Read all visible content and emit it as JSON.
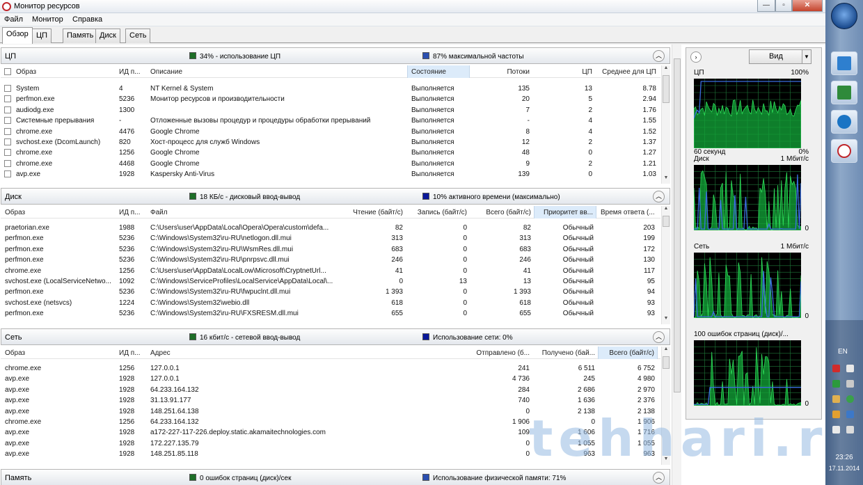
{
  "window": {
    "title": "Монитор ресурсов"
  },
  "menu": [
    "Файл",
    "Монитор",
    "Справка"
  ],
  "tabs": [
    "Обзор",
    "ЦП",
    "Память",
    "Диск",
    "Сеть"
  ],
  "cpu": {
    "title": "ЦП",
    "metric1": "34% - использование ЦП",
    "metric2": "87% максимальной частоты",
    "columns": [
      "Образ",
      "ИД п...",
      "Описание",
      "Состояние",
      "Потоки",
      "ЦП",
      "Среднее для ЦП"
    ],
    "rows": [
      [
        "System",
        "4",
        "NT Kernel & System",
        "Выполняется",
        "135",
        "13",
        "8.78"
      ],
      [
        "perfmon.exe",
        "5236",
        "Монитор ресурсов и производительности",
        "Выполняется",
        "20",
        "5",
        "2.94"
      ],
      [
        "audiodg.exe",
        "1300",
        "",
        "Выполняется",
        "7",
        "2",
        "1.76"
      ],
      [
        "Системные прерывания",
        "-",
        "Отложенные вызовы процедур и процедуры обработки прерываний",
        "Выполняется",
        "-",
        "4",
        "1.55"
      ],
      [
        "chrome.exe",
        "4476",
        "Google Chrome",
        "Выполняется",
        "8",
        "4",
        "1.52"
      ],
      [
        "svchost.exe (DcomLaunch)",
        "820",
        "Хост-процесс для служб Windows",
        "Выполняется",
        "12",
        "2",
        "1.37"
      ],
      [
        "chrome.exe",
        "1256",
        "Google Chrome",
        "Выполняется",
        "48",
        "0",
        "1.27"
      ],
      [
        "chrome.exe",
        "4468",
        "Google Chrome",
        "Выполняется",
        "9",
        "2",
        "1.21"
      ],
      [
        "avp.exe",
        "1928",
        "Kaspersky Anti-Virus",
        "Выполняется",
        "139",
        "0",
        "1.03"
      ]
    ]
  },
  "disk": {
    "title": "Диск",
    "metric1": "18 КБ/с - дисковый ввод-вывод",
    "metric2": "10% активного времени (максимально)",
    "columns": [
      "Образ",
      "ИД п...",
      "Файл",
      "Чтение (байт/с)",
      "Запись (байт/с)",
      "Всего (байт/с)",
      "Приоритет вв...",
      "Время ответа (..."
    ],
    "rows": [
      [
        "praetorian.exe",
        "1988",
        "C:\\Users\\user\\AppData\\Local\\Opera\\Opera\\custom\\defa...",
        "82",
        "0",
        "82",
        "Обычный",
        "203"
      ],
      [
        "perfmon.exe",
        "5236",
        "C:\\Windows\\System32\\ru-RU\\netlogon.dll.mui",
        "313",
        "0",
        "313",
        "Обычный",
        "199"
      ],
      [
        "perfmon.exe",
        "5236",
        "C:\\Windows\\System32\\ru-RU\\WsmRes.dll.mui",
        "683",
        "0",
        "683",
        "Обычный",
        "172"
      ],
      [
        "perfmon.exe",
        "5236",
        "C:\\Windows\\System32\\ru-RU\\pnrpsvc.dll.mui",
        "246",
        "0",
        "246",
        "Обычный",
        "130"
      ],
      [
        "chrome.exe",
        "1256",
        "C:\\Users\\user\\AppData\\LocalLow\\Microsoft\\CryptnetUrl...",
        "41",
        "0",
        "41",
        "Обычный",
        "117"
      ],
      [
        "svchost.exe (LocalServiceNetwo...",
        "1092",
        "C:\\Windows\\ServiceProfiles\\LocalService\\AppData\\Local\\...",
        "0",
        "13",
        "13",
        "Обычный",
        "95"
      ],
      [
        "perfmon.exe",
        "5236",
        "C:\\Windows\\System32\\ru-RU\\fwpuclnt.dll.mui",
        "1 393",
        "0",
        "1 393",
        "Обычный",
        "94"
      ],
      [
        "svchost.exe (netsvcs)",
        "1224",
        "C:\\Windows\\System32\\webio.dll",
        "618",
        "0",
        "618",
        "Обычный",
        "93"
      ],
      [
        "perfmon.exe",
        "5236",
        "C:\\Windows\\System32\\ru-RU\\FXSRESM.dll.mui",
        "655",
        "0",
        "655",
        "Обычный",
        "93"
      ]
    ]
  },
  "network": {
    "title": "Сеть",
    "metric1": "16 кбит/с - сетевой ввод-вывод",
    "metric2": "Использование сети: 0%",
    "columns": [
      "Образ",
      "ИД п...",
      "Адрес",
      "Отправлено (б...",
      "Получено (бай...",
      "Всего (байт/с)"
    ],
    "rows": [
      [
        "chrome.exe",
        "1256",
        "127.0.0.1",
        "241",
        "6 511",
        "6 752"
      ],
      [
        "avp.exe",
        "1928",
        "127.0.0.1",
        "4 736",
        "245",
        "4 980"
      ],
      [
        "avp.exe",
        "1928",
        "64.233.164.132",
        "284",
        "2 686",
        "2 970"
      ],
      [
        "avp.exe",
        "1928",
        "31.13.91.177",
        "740",
        "1 636",
        "2 376"
      ],
      [
        "avp.exe",
        "1928",
        "148.251.64.138",
        "0",
        "2 138",
        "2 138"
      ],
      [
        "chrome.exe",
        "1256",
        "64.233.164.132",
        "1 906",
        "0",
        "1 906"
      ],
      [
        "avp.exe",
        "1928",
        "a172-227-117-226.deploy.static.akamaitechnologies.com",
        "109",
        "1 606",
        "1 716"
      ],
      [
        "avp.exe",
        "1928",
        "172.227.135.79",
        "0",
        "1 055",
        "1 055"
      ],
      [
        "avp.exe",
        "1928",
        "148.251.85.118",
        "0",
        "963",
        "963"
      ]
    ]
  },
  "memory": {
    "title": "Память",
    "metric1": "0 ошибок страниц (диск)/сек",
    "metric2": "Использование физической памяти: 71%"
  },
  "right_panel": {
    "view_label": "Вид",
    "graphs": [
      {
        "name": "ЦП",
        "max": "100%",
        "bottom_left": "60 секунд",
        "bottom_right": "0%"
      },
      {
        "name": "Диск",
        "max": "1 Мбит/с",
        "bottom_left": "",
        "bottom_right": "0"
      },
      {
        "name": "Сеть",
        "max": "1 Мбит/с",
        "bottom_left": "",
        "bottom_right": "0"
      },
      {
        "name": "100 ошибок страниц (диск)/...",
        "max": "",
        "bottom_left": "",
        "bottom_right": "0"
      }
    ]
  },
  "taskbar": {
    "lang": "EN",
    "time": "23:26",
    "date": "17.11.2014"
  },
  "watermark": "tehhari.ru",
  "colors": {
    "graph_bg": "#000000",
    "graph_grid": "#1f7a3a",
    "graph_fill": "#13a83a",
    "graph_line": "#3b6de0"
  }
}
